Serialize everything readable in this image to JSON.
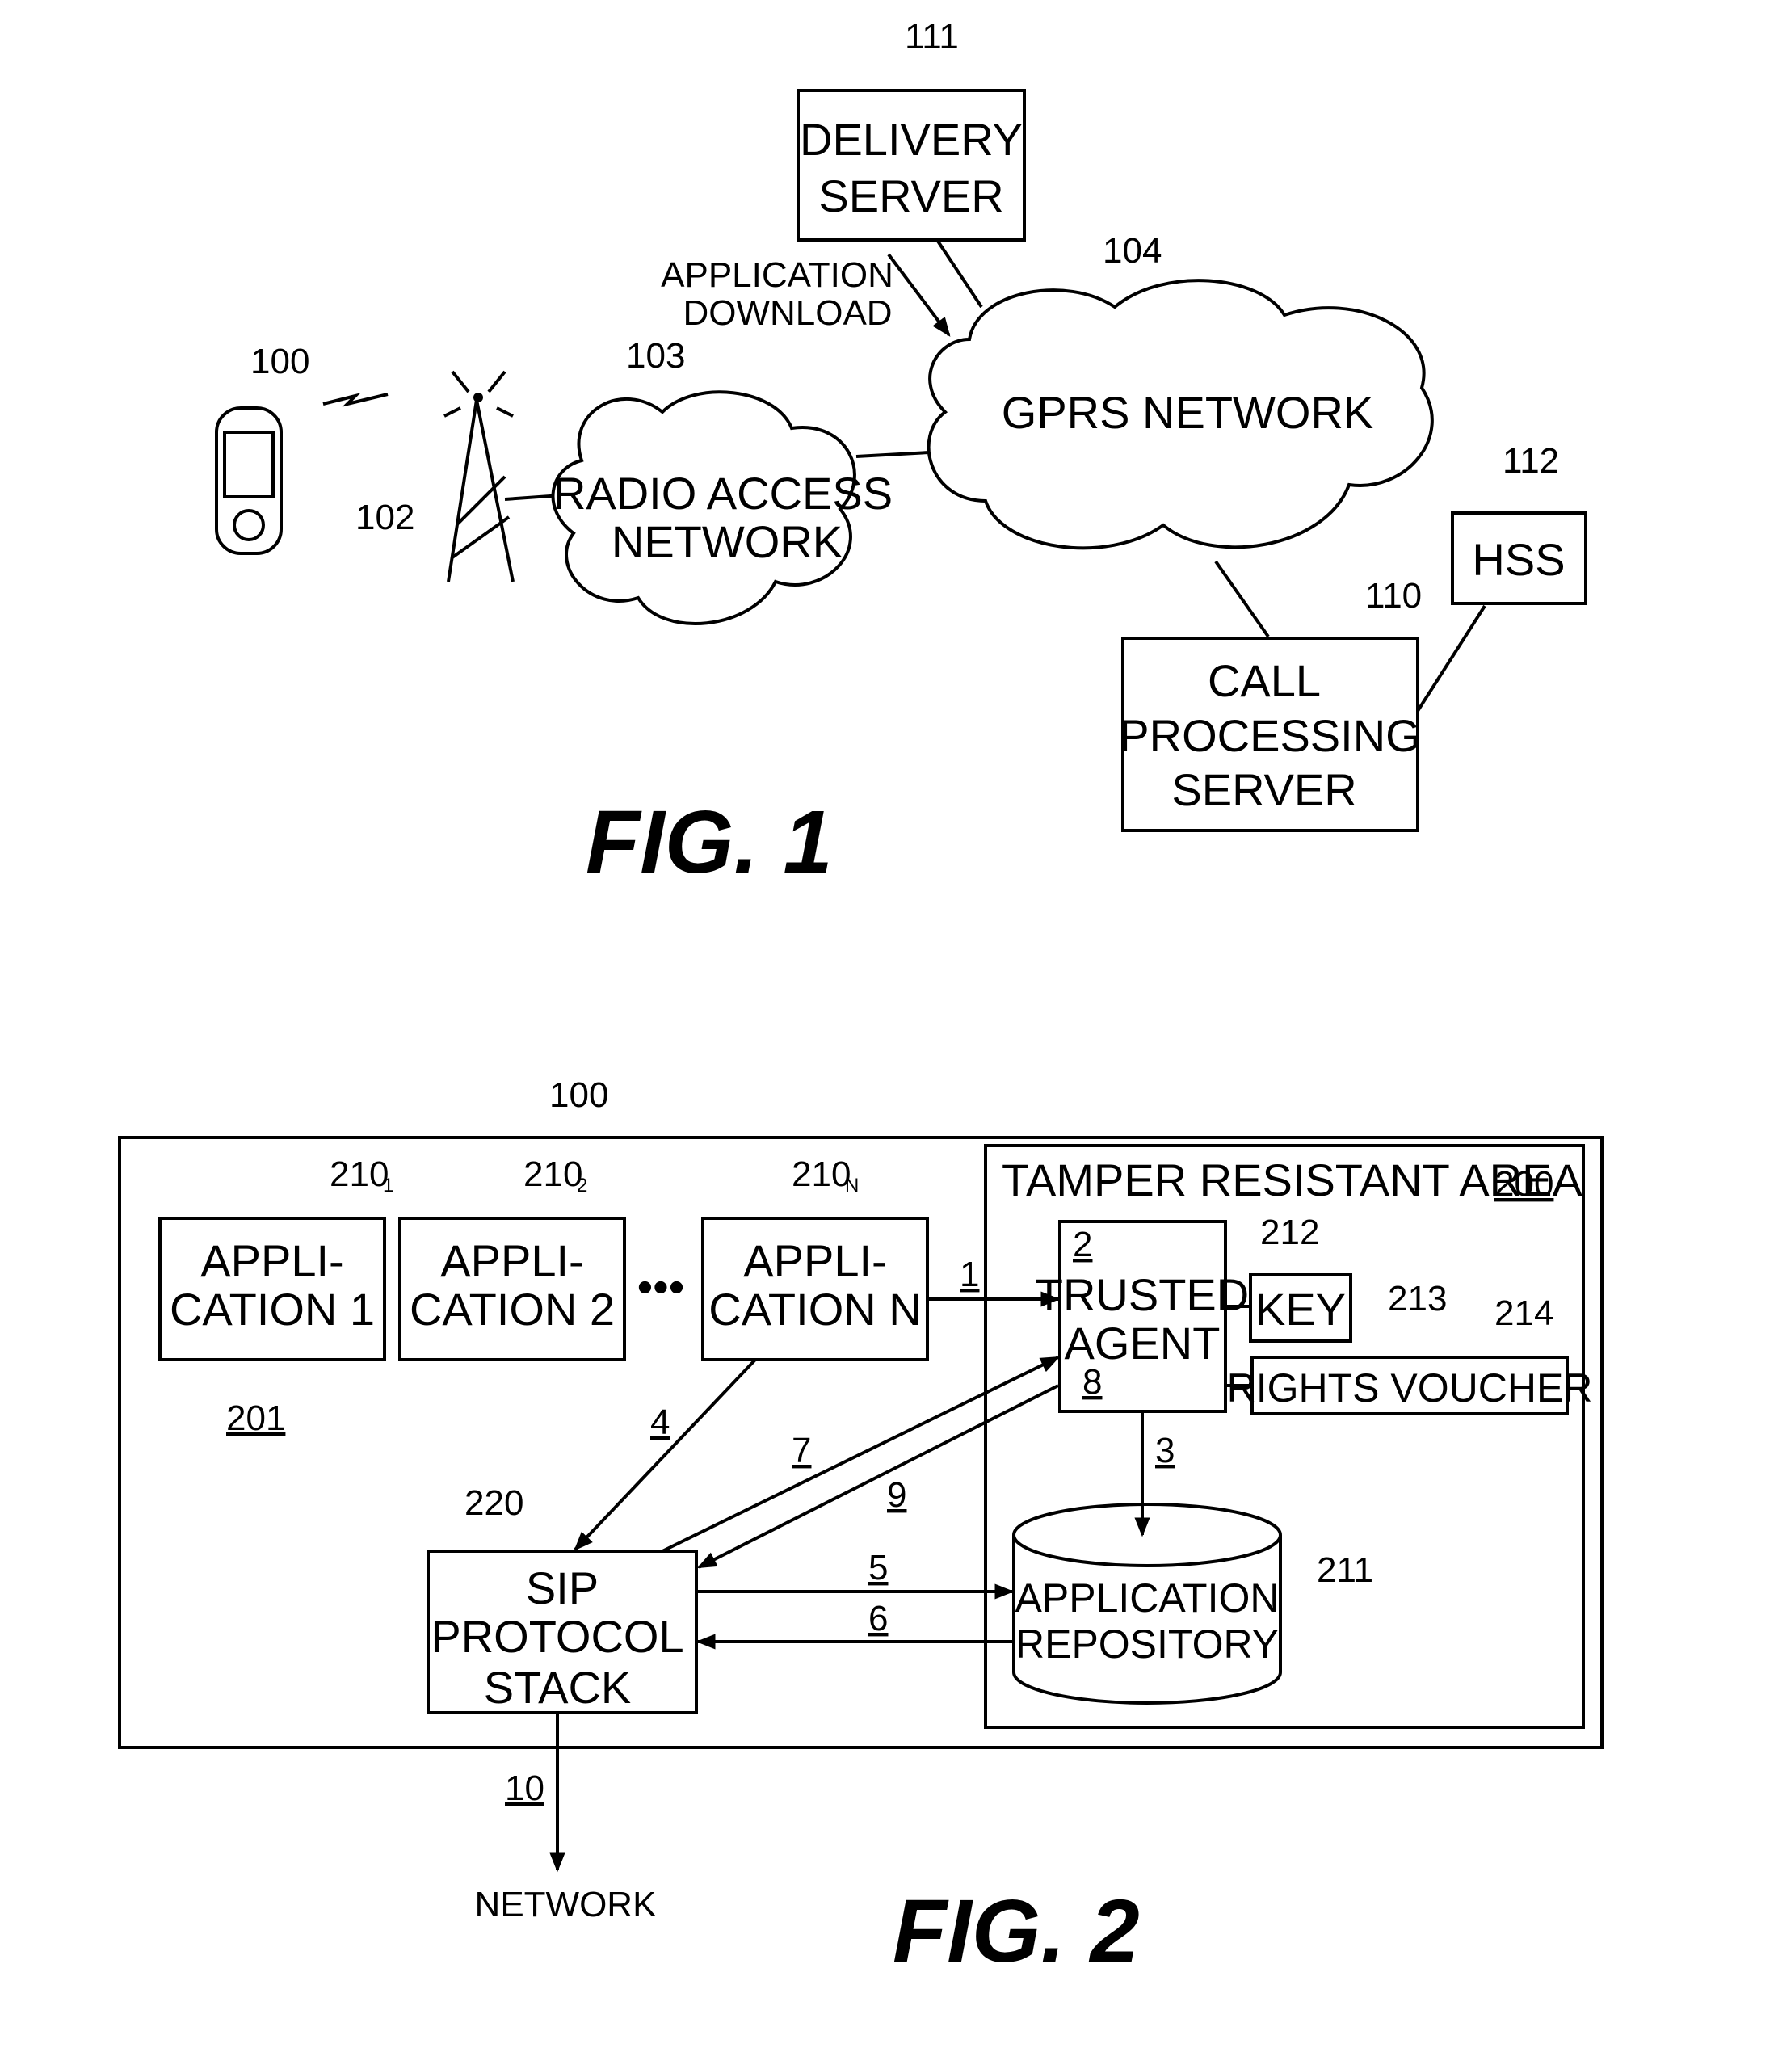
{
  "fig1": {
    "caption": "FIG. 1",
    "nodes": {
      "mobile": {
        "ref": "100"
      },
      "tower": {
        "ref": "102"
      },
      "ran": {
        "ref": "103",
        "lines": [
          "RADIO ACCESS",
          "NETWORK"
        ]
      },
      "gprs": {
        "ref": "104",
        "lines": [
          "GPRS NETWORK"
        ]
      },
      "delivery": {
        "ref": "111",
        "lines": [
          "DELIVERY",
          "SERVER"
        ]
      },
      "hss": {
        "ref": "112",
        "lines": [
          "HSS"
        ]
      },
      "cps": {
        "ref": "110",
        "lines": [
          "CALL",
          "PROCESSING",
          "SERVER"
        ]
      }
    },
    "annotation": [
      "APPLICATION",
      "DOWNLOAD"
    ]
  },
  "fig2": {
    "caption": "FIG. 2",
    "device_ref": "100",
    "area_ref": "201",
    "tamper": {
      "title": "TAMPER RESISTANT AREA",
      "ref": "200"
    },
    "apps": [
      {
        "ref": "210",
        "sub": "1",
        "lines": [
          "APPLI-",
          "CATION 1"
        ]
      },
      {
        "ref": "210",
        "sub": "2",
        "lines": [
          "APPLI-",
          "CATION 2"
        ]
      },
      {
        "ref": "210",
        "sub": "N",
        "lines": [
          "APPLI-",
          "CATION N"
        ]
      }
    ],
    "ellipsis": "•••",
    "trusted": {
      "ref": "212",
      "lines": [
        "TRUSTED",
        "AGENT"
      ],
      "step_top": "2",
      "step_bottom": "8"
    },
    "key": {
      "ref": "213",
      "label": "KEY"
    },
    "voucher": {
      "ref": "214",
      "label": "RIGHTS VOUCHER"
    },
    "repo": {
      "ref": "211",
      "lines": [
        "APPLICATION",
        "REPOSITORY"
      ]
    },
    "sip": {
      "ref": "220",
      "lines": [
        "SIP",
        "PROTOCOL",
        "STACK"
      ]
    },
    "steps": {
      "s1": "1",
      "s3": "3",
      "s4": "4",
      "s5": "5",
      "s6": "6",
      "s7": "7",
      "s9": "9",
      "s10": "10"
    },
    "network": "NETWORK"
  }
}
